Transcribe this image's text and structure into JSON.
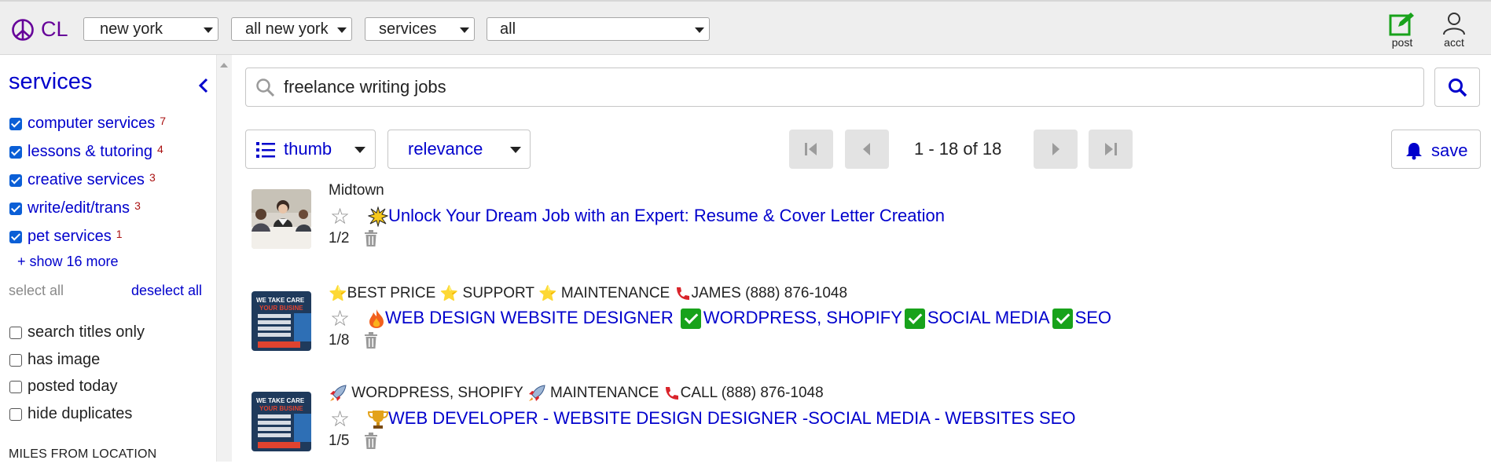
{
  "header": {
    "logo": "CL",
    "selects": [
      "new york",
      "all new york",
      "services",
      "all"
    ],
    "post_label": "post",
    "acct_label": "acct"
  },
  "sidebar": {
    "title": "services",
    "categories": [
      {
        "label": "computer services",
        "count": "7"
      },
      {
        "label": "lessons & tutoring",
        "count": "4"
      },
      {
        "label": "creative services",
        "count": "3"
      },
      {
        "label": "write/edit/trans",
        "count": "3"
      },
      {
        "label": "pet services",
        "count": "1"
      }
    ],
    "show_more": "+ show 16 more",
    "select_all": "select all",
    "deselect_all": "deselect all",
    "options": [
      "search titles only",
      "has image",
      "posted today",
      "hide duplicates"
    ],
    "miles_heading": "MILES FROM LOCATION"
  },
  "search": {
    "value": "freelance writing jobs"
  },
  "toolbar": {
    "view_label": "thumb",
    "sort_label": "relevance",
    "page_info": "1 - 18 of 18",
    "save_label": "save"
  },
  "results": [
    {
      "location": "Midtown",
      "title": "Unlock Your Dream Job with an Expert: Resume & Cover Letter Creation",
      "count": "1/2"
    },
    {
      "location_parts": [
        "BEST PRICE ",
        " SUPPORT ",
        " MAINTENANCE ",
        "JAMES (888) 876-1048"
      ],
      "title_parts": [
        "WEB DESIGN WEBSITE DESIGNER ",
        "WORDPRESS, SHOPIFY",
        "SOCIAL MEDIA",
        "SEO"
      ],
      "count": "1/8"
    },
    {
      "location_parts": [
        " WORDPRESS, SHOPIFY ",
        " MAINTENANCE ",
        "CALL (888) 876-1048"
      ],
      "title": "WEB DEVELOPER - WEBSITE DESIGN DESIGNER -SOCIAL MEDIA - WEBSITES SEO",
      "count": "1/5"
    }
  ]
}
